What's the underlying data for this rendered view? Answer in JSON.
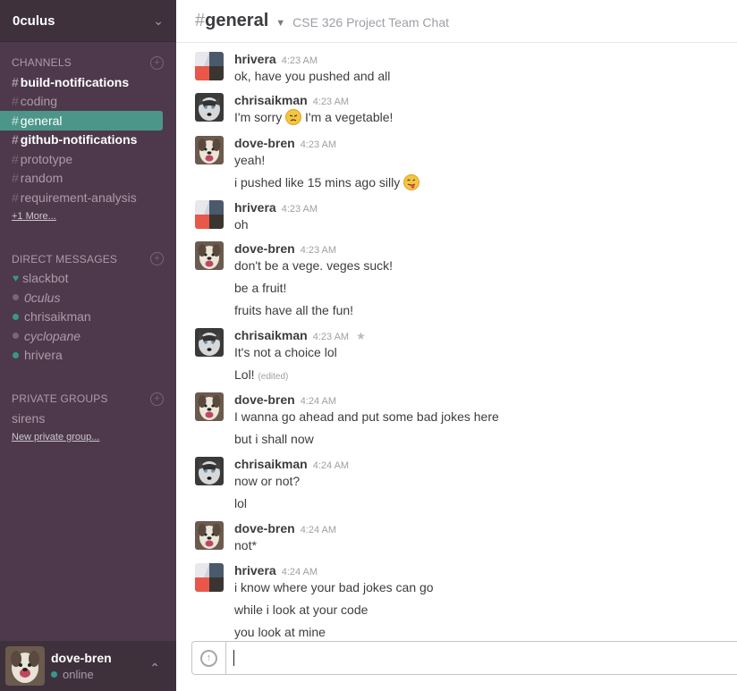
{
  "team": {
    "name": "0culus"
  },
  "sidebar": {
    "channels_label": "CHANNELS",
    "channels": [
      {
        "name": "build-notifications",
        "state": "unread"
      },
      {
        "name": "coding",
        "state": "normal"
      },
      {
        "name": "general",
        "state": "active"
      },
      {
        "name": "github-notifications",
        "state": "unread"
      },
      {
        "name": "prototype",
        "state": "normal"
      },
      {
        "name": "random",
        "state": "normal"
      },
      {
        "name": "requirement-analysis",
        "state": "normal"
      }
    ],
    "more_label": "+1 More...",
    "dm_label": "DIRECT MESSAGES",
    "dms": [
      {
        "name": "slackbot",
        "presence": "bot"
      },
      {
        "name": "0culus",
        "presence": "away"
      },
      {
        "name": "chrisaikman",
        "presence": "online"
      },
      {
        "name": "cyclopane",
        "presence": "away"
      },
      {
        "name": "hrivera",
        "presence": "online"
      }
    ],
    "groups_label": "PRIVATE GROUPS",
    "groups": [
      {
        "name": "sirens"
      }
    ],
    "new_group_label": "New private group..."
  },
  "footer": {
    "username": "dove-bren",
    "status": "online"
  },
  "channel": {
    "hash": "#",
    "name": "general",
    "purpose": "CSE 326 Project Team Chat"
  },
  "messages": [
    {
      "author": "hrivera",
      "time": "4:23 AM",
      "avatar": "grid",
      "lines": [
        {
          "text": "ok, have you pushed and all"
        }
      ]
    },
    {
      "author": "chrisaikman",
      "time": "4:23 AM",
      "avatar": "husky",
      "lines": [
        {
          "text": "I'm sorry",
          "emoji": "disappointed",
          "after": "I'm a vegetable!"
        }
      ]
    },
    {
      "author": "dove-bren",
      "time": "4:23 AM",
      "avatar": "dog",
      "lines": [
        {
          "text": "yeah!"
        },
        {
          "text": "i pushed like 15 mins ago silly",
          "emoji": "stuck_out_tongue"
        }
      ]
    },
    {
      "author": "hrivera",
      "time": "4:23 AM",
      "avatar": "grid",
      "lines": [
        {
          "text": "oh"
        }
      ]
    },
    {
      "author": "dove-bren",
      "time": "4:23 AM",
      "avatar": "dog",
      "lines": [
        {
          "text": "don't be a vege. veges suck!"
        },
        {
          "text": "be a fruit!"
        },
        {
          "text": "fruits have all the fun!"
        }
      ]
    },
    {
      "author": "chrisaikman",
      "time": "4:23 AM",
      "avatar": "husky",
      "starred": true,
      "lines": [
        {
          "text": "It's not a choice lol"
        },
        {
          "text": "Lol!",
          "edited": "(edited)"
        }
      ]
    },
    {
      "author": "dove-bren",
      "time": "4:24 AM",
      "avatar": "dog",
      "lines": [
        {
          "text": "I wanna go ahead and put some bad jokes here"
        },
        {
          "text": "but i shall now"
        }
      ]
    },
    {
      "author": "chrisaikman",
      "time": "4:24 AM",
      "avatar": "husky",
      "lines": [
        {
          "text": "now or not?"
        },
        {
          "text": "lol"
        }
      ]
    },
    {
      "author": "dove-bren",
      "time": "4:24 AM",
      "avatar": "dog",
      "lines": [
        {
          "text": "not*"
        }
      ]
    },
    {
      "author": "hrivera",
      "time": "4:24 AM",
      "avatar": "grid",
      "lines": [
        {
          "text": "i know where your bad jokes can go"
        },
        {
          "text": "while i look at your code"
        },
        {
          "text": "you look at mine"
        }
      ]
    }
  ],
  "input": {
    "value": ""
  }
}
